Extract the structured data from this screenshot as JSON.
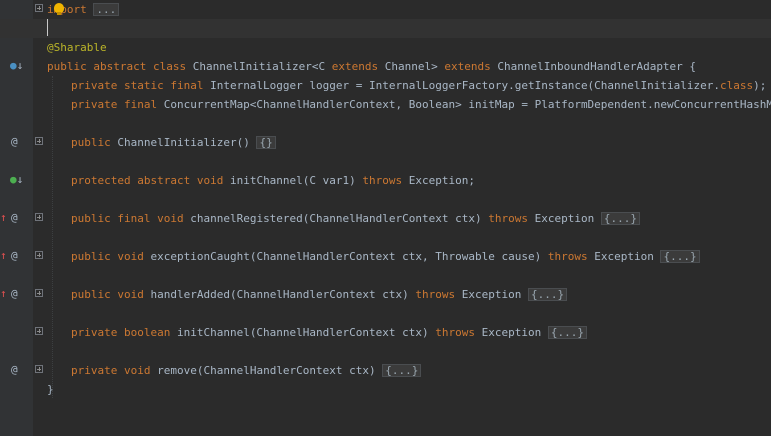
{
  "editor": {
    "lines": {
      "import": {
        "kw": "import",
        "folded": "..."
      },
      "annotation": "@Sharable",
      "class_decl": {
        "kw1": "public abstract class",
        "name": " ChannelInitializer",
        "generic_open": "<C ",
        "kw_extends": "extends",
        "generic_type": " Channel> ",
        "kw_extends2": "extends",
        "parent": " ChannelInboundHandlerAdapter {"
      },
      "logger": {
        "kw": "private static final",
        "rest": " InternalLogger logger = InternalLoggerFactory.getInstance(ChannelInitializer.",
        "kw2": "class",
        "end": ");"
      },
      "initmap": {
        "kw": "private final",
        "rest": " ConcurrentMap<ChannelHandlerContext, Boolean> initMap = PlatformDependent.newConcurrentHashMap();"
      },
      "constructor": {
        "kw": "public",
        "rest": " ChannelInitializer() ",
        "folded": "{}"
      },
      "init_abstract": {
        "kw": "protected abstract void",
        "rest": " initChannel(C var1) ",
        "kw2": "throws",
        "end": " Exception;"
      },
      "channel_registered": {
        "kw": "public final void",
        "rest": " channelRegistered(ChannelHandlerContext ctx) ",
        "kw2": "throws",
        "end": " Exception ",
        "folded": "{...}"
      },
      "exception_caught": {
        "kw": "public void",
        "rest": " exceptionCaught(ChannelHandlerContext ctx, Throwable cause) ",
        "kw2": "throws",
        "end": " Exception ",
        "folded": "{...}"
      },
      "handler_added": {
        "kw": "public void",
        "rest": " handlerAdded(ChannelHandlerContext ctx) ",
        "kw2": "throws",
        "end": " Exception ",
        "folded": "{...}"
      },
      "init_private": {
        "kw": "private boolean",
        "rest": " initChannel(ChannelHandlerContext ctx) ",
        "kw2": "throws",
        "end": " Exception ",
        "folded": "{...}"
      },
      "remove": {
        "kw": "private void",
        "rest": " remove(ChannelHandlerContext ctx) ",
        "folded": "{...}"
      },
      "close": "}"
    },
    "gutter_icons": {
      "class": "implemented-down-icon",
      "at": "@",
      "override_up": "↑",
      "implemented_down": "↓"
    },
    "colors": {
      "keyword": "#cc7832",
      "annotation": "#bbb529",
      "text": "#a9b7c6",
      "background": "#2b2b2b",
      "gutter": "#313335"
    }
  }
}
